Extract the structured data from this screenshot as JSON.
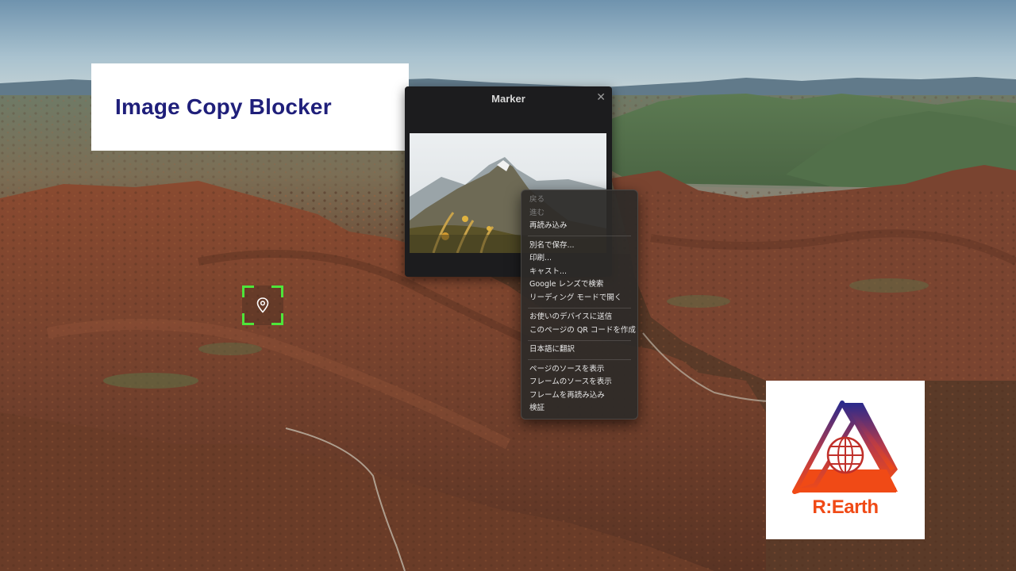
{
  "title_card": {
    "text": "Image Copy Blocker"
  },
  "infobox": {
    "title": "Marker",
    "close_glyph": "✕"
  },
  "context_menu": {
    "groups": [
      [
        {
          "label": "戻る",
          "disabled": true
        },
        {
          "label": "進む",
          "disabled": true
        },
        {
          "label": "再読み込み",
          "disabled": false
        }
      ],
      [
        {
          "label": "別名で保存...",
          "disabled": false
        },
        {
          "label": "印刷...",
          "disabled": false
        },
        {
          "label": "キャスト...",
          "disabled": false
        },
        {
          "label": "Google レンズで検索",
          "disabled": false
        },
        {
          "label": "リーディング モードで開く",
          "disabled": false
        }
      ],
      [
        {
          "label": "お使いのデバイスに送信",
          "disabled": false
        },
        {
          "label": "このページの QR コードを作成",
          "disabled": false
        }
      ],
      [
        {
          "label": "日本語に翻訳",
          "disabled": false
        }
      ],
      [
        {
          "label": "ページのソースを表示",
          "disabled": false
        },
        {
          "label": "フレームのソースを表示",
          "disabled": false
        },
        {
          "label": "フレームを再読み込み",
          "disabled": false
        },
        {
          "label": "検証",
          "disabled": false
        }
      ]
    ]
  },
  "marker": {
    "icon": "map-pin-icon",
    "selection_color": "#4ee53a"
  },
  "logo": {
    "text": "R:Earth",
    "gradient_top": "#2a2a8c",
    "gradient_bottom": "#f04a16"
  }
}
